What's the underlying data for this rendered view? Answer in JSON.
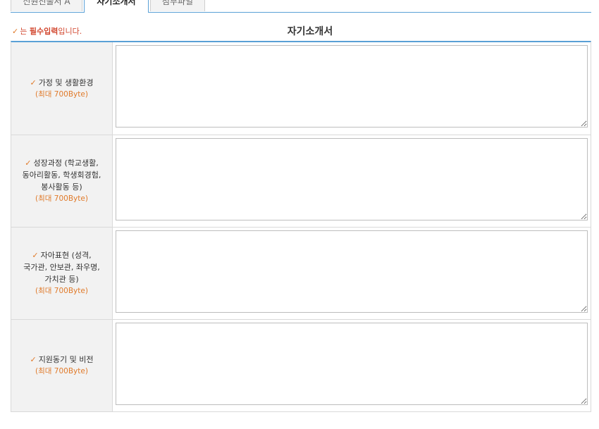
{
  "tabs": [
    {
      "label": "신원진술서 A"
    },
    {
      "label": "자기소개서"
    },
    {
      "label": "첨부파일"
    }
  ],
  "required_note": {
    "check": "✓",
    "prefix": "는 ",
    "bold": "필수입력",
    "suffix": "입니다."
  },
  "section_title": "자기소개서",
  "fields": [
    {
      "check": "✓",
      "label_lines": [
        "가정 및 생활환경"
      ],
      "limit": "(최대 700Byte)",
      "value": ""
    },
    {
      "check": "✓",
      "label_lines": [
        "성장과정 (학교생활,",
        "동아리활동, 학생회경험,",
        "봉사활동 등)"
      ],
      "limit": "(최대 700Byte)",
      "value": ""
    },
    {
      "check": "✓",
      "label_lines": [
        "자아표현 (성격,",
        "국가관, 안보관, 좌우명,",
        "가치관 등)"
      ],
      "limit": "(최대 700Byte)",
      "value": ""
    },
    {
      "check": "✓",
      "label_lines": [
        "지원동기 및 비전"
      ],
      "limit": "(최대 700Byte)",
      "value": ""
    }
  ]
}
